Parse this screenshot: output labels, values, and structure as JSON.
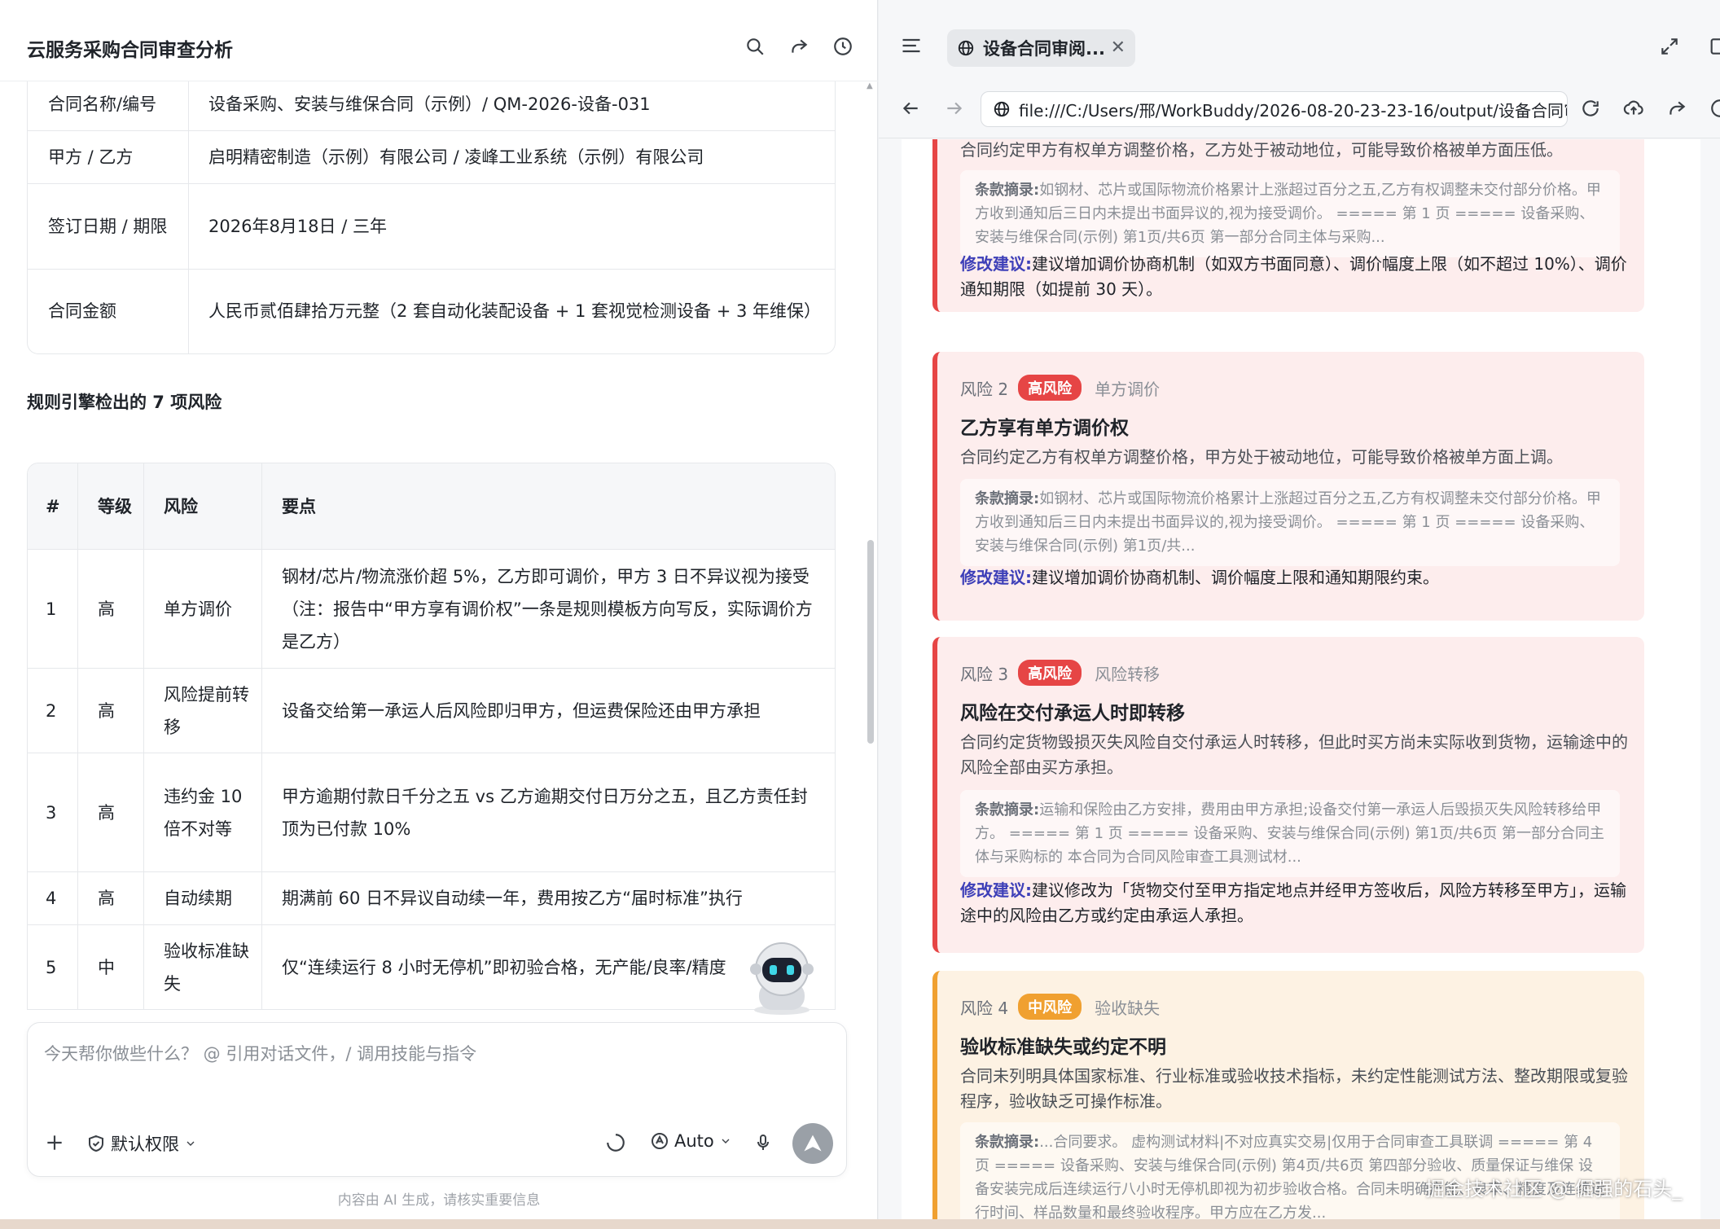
{
  "left": {
    "title": "云服务采购合同审查分析",
    "info_rows": [
      {
        "k": "合同名称/编号",
        "v": "设备采购、安装与维保合同（示例）/ QM-2026-设备-031"
      },
      {
        "k": "甲方 / 乙方",
        "v": "启明精密制造（示例）有限公司 / 凌峰工业系统（示例）有限公司"
      },
      {
        "k": "签订日期 / 期限",
        "v": "2026年8月18日 / 三年"
      },
      {
        "k": "合同金额",
        "v": "人民币贰佰肆拾万元整（2 套自动化装配设备 + 1 套视觉检测设备 + 3 年维保）"
      }
    ],
    "risk_heading": "规则引擎检出的 7 项风险",
    "risk_table": {
      "headers": [
        "#",
        "等级",
        "风险",
        "要点"
      ],
      "rows": [
        {
          "no": "1",
          "level": "高",
          "risk": "单方调价",
          "point": "钢材/芯片/物流涨价超 5%，乙方即可调价，甲方 3 日不异议视为接受（注：报告中“甲方享有调价权”一条是规则模板方向写反，实际调价方是乙方）"
        },
        {
          "no": "2",
          "level": "高",
          "risk": "风险提前转移",
          "point": "设备交给第一承运人后风险即归甲方，但运费保险还由甲方承担"
        },
        {
          "no": "3",
          "level": "高",
          "risk": "违约金 10 倍不对等",
          "point": "甲方逾期付款日千分之五 vs 乙方逾期交付日万分之五，且乙方责任封顶为已付款 10%"
        },
        {
          "no": "4",
          "level": "高",
          "risk": "自动续期",
          "point": "期满前 60 日不异议自动续一年，费用按乙方“届时标准”执行"
        },
        {
          "no": "5",
          "level": "中",
          "risk": "验收标准缺失",
          "point": "仅“连续运行 8 小时无停机”即初验合格，无产能/良率/精度"
        }
      ]
    },
    "input": {
      "placeholder": "今天帮你做些什么？ @ 引用对话文件，/ 调用技能与指令",
      "permission_label": "默认权限",
      "model_label": "Auto"
    },
    "disclaimer": "内容由 AI 生成，请核实重要信息"
  },
  "right": {
    "tab_title": "设备合同审阅...",
    "url": "file:///C:/Users/邢/WorkBuddy/2026-08-20-23-23-16/output/设备合同审阅报",
    "cards": [
      {
        "desc": "合同约定甲方有权单方调整价格，乙方处于被动地位，可能导致价格被单方面压低。",
        "excerpt_label": "条款摘录:",
        "excerpt": "如钢材、芯片或国际物流价格累计上涨超过百分之五,乙方有权调整未交付部分价格。甲方收到通知后三日内未提出书面异议的,视为接受调价。 ===== 第 1 页 ===== 设备采购、安装与维保合同(示例) 第1页/共6页 第一部分合同主体与采购...",
        "suggest_label": "修改建议:",
        "suggest": "建议增加调价协商机制（如双方书面同意）、调价幅度上限（如不超过 10%）、调价通知期限（如提前 30 天）。"
      },
      {
        "risk_no": "风险 2",
        "badge": "高风险",
        "category": "单方调价",
        "title": "乙方享有单方调价权",
        "desc": "合同约定乙方有权单方调整价格，甲方处于被动地位，可能导致价格被单方面上调。",
        "excerpt_label": "条款摘录:",
        "excerpt": "如钢材、芯片或国际物流价格累计上涨超过百分之五,乙方有权调整未交付部分价格。甲方收到通知后三日内未提出书面异议的,视为接受调价。 ===== 第 1 页 ===== 设备采购、安装与维保合同(示例) 第1页/共...",
        "suggest_label": "修改建议:",
        "suggest": "建议增加调价协商机制、调价幅度上限和通知期限约束。"
      },
      {
        "risk_no": "风险 3",
        "badge": "高风险",
        "category": "风险转移",
        "title": "风险在交付承运人时即转移",
        "desc": "合同约定货物毁损灭失风险自交付承运人时转移，但此时买方尚未实际收到货物，运输途中的风险全部由买方承担。",
        "excerpt_label": "条款摘录:",
        "excerpt": "运输和保险由乙方安排，费用由甲方承担;设备交付第一承运人后毁损灭失风险转移给甲方。 ===== 第 1 页 ===== 设备采购、安装与维保合同(示例) 第1页/共6页 第一部分合同主体与采购标的 本合同为合同风险审查工具测试材...",
        "suggest_label": "修改建议:",
        "suggest": "建议修改为「货物交付至甲方指定地点并经甲方签收后，风险方转移至甲方」，运输途中的风险由乙方或约定由承运人承担。"
      },
      {
        "risk_no": "风险 4",
        "badge": "中风险",
        "category": "验收缺失",
        "title": "验收标准缺失或约定不明",
        "desc": "合同未列明具体国家标准、行业标准或验收技术指标，未约定性能测试方法、整改期限或复验程序，验收缺乏可操作标准。",
        "excerpt_label": "条款摘录:",
        "excerpt": "...合同要求。 虚构测试材料|不对应真实交易|仅用于合同审查工具联调 ===== 第 4 页 ===== 设备采购、安装与维保合同(示例) 第4页/共6页 第四部分验收、质量保证与维保 设备安装完成后连续运行八小时无停机即视为初步验收合格。合同未明确产能、良率、精度及连续运行时间、样品数量和最终验收程序。甲方应在乙方发..."
      }
    ],
    "watermark": "掘金技术社区 @ 倔强的石头_"
  },
  "colors": {
    "high_risk": "#e64545",
    "mid_risk": "#f0a030",
    "suggest_label": "#3d3fb8"
  },
  "icons": {
    "left_header": [
      "search-icon",
      "share-icon",
      "history-icon"
    ],
    "input_tools": [
      "plus-icon",
      "shield-check-icon",
      "chevron-down-icon",
      "loading-icon",
      "auto-icon",
      "microphone-icon",
      "send-icon"
    ],
    "right_toolbar": [
      "menu-icon",
      "globe-icon",
      "close-icon",
      "expand-icon",
      "window-icon",
      "back-icon",
      "forward-icon",
      "reload-icon",
      "upload-icon",
      "share-icon",
      "globe-icon"
    ]
  }
}
